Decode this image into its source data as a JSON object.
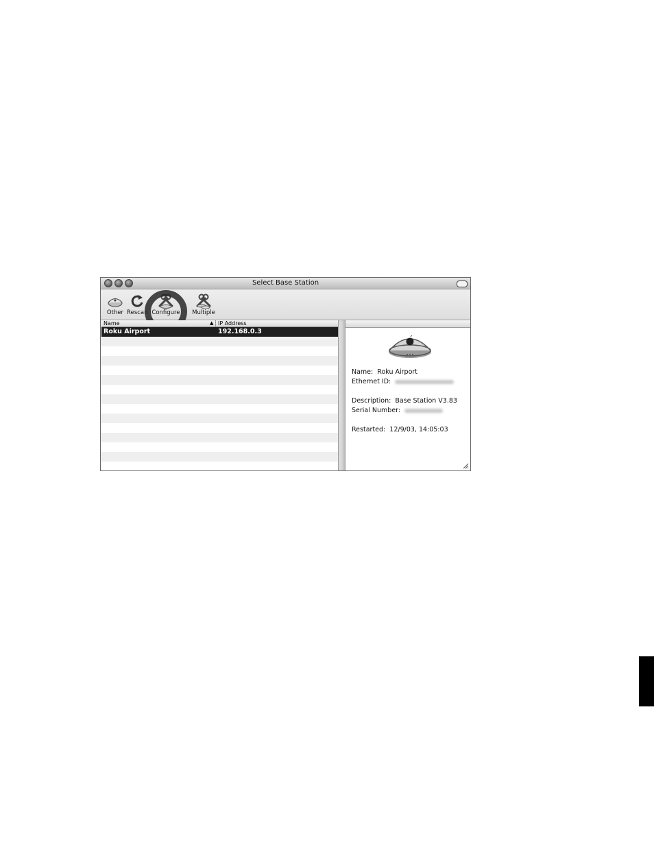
{
  "window": {
    "title": "Select Base Station"
  },
  "toolbar": {
    "buttons": [
      {
        "label": "Other",
        "icon": "base-station-icon"
      },
      {
        "label": "Rescan",
        "icon": "rescan-icon"
      },
      {
        "label": "Configure",
        "icon": "configure-wrench-icon"
      },
      {
        "label": "Multiple",
        "icon": "multiple-wrench-icon"
      }
    ]
  },
  "list": {
    "columns": {
      "name": "Name",
      "ip": "IP Address"
    },
    "rows": [
      {
        "name": "Roku Airport",
        "ip": "192.168.0.3",
        "selected": true
      }
    ]
  },
  "info": {
    "name_label": "Name:",
    "name_value": "Roku Airport",
    "ethernet_label": "Ethernet ID:",
    "description_label": "Description:",
    "description_value": "Base Station V3.83",
    "serial_label": "Serial Number:",
    "restarted_label": "Restarted:",
    "restarted_value": "12/9/03, 14:05:03"
  }
}
